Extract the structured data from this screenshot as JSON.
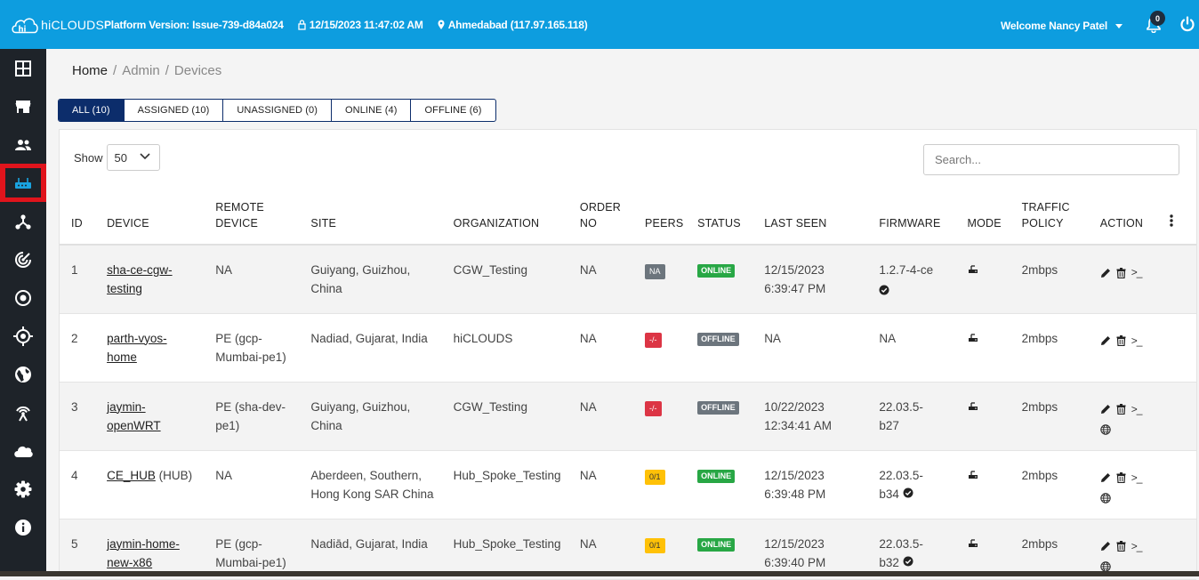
{
  "header": {
    "logo_text": "hiCLOUDS",
    "platform_version": "Platform Version: Issue-739-d84a024",
    "datetime": "12/15/2023 11:47:02 AM",
    "location": "Ahmedabad (117.97.165.118)",
    "welcome": "Welcome Nancy Patel",
    "notification_count": "0",
    "brand_color": "#0d9ddf"
  },
  "sidebar": {
    "items": [
      {
        "icon": "dashboard-grid-icon"
      },
      {
        "icon": "store-icon"
      },
      {
        "icon": "users-icon"
      },
      {
        "icon": "router-icon",
        "active": true
      },
      {
        "icon": "topology-icon"
      },
      {
        "icon": "signal-icon"
      },
      {
        "icon": "target-circle-icon"
      },
      {
        "icon": "crosshair-icon"
      },
      {
        "icon": "globe-icon"
      },
      {
        "icon": "wireless-tower-icon"
      },
      {
        "icon": "cloud-icon"
      },
      {
        "icon": "settings-gear-icon"
      },
      {
        "icon": "info-icon"
      }
    ]
  },
  "breadcrumb": {
    "home": "Home",
    "admin": "Admin",
    "devices": "Devices"
  },
  "tabs": [
    {
      "label": "ALL (10)",
      "active": true
    },
    {
      "label": "ASSIGNED (10)"
    },
    {
      "label": "UNASSIGNED (0)"
    },
    {
      "label": "ONLINE (4)"
    },
    {
      "label": "OFFLINE (6)"
    }
  ],
  "controls": {
    "show_label": "Show",
    "show_value": "50",
    "search_placeholder": "Search..."
  },
  "table": {
    "headers": {
      "id": "ID",
      "device": "DEVICE",
      "remote_1": "REMOTE",
      "remote_2": "DEVICE",
      "site": "SITE",
      "organization": "ORGANIZATION",
      "order_1": "ORDER",
      "order_2": "NO",
      "peers": "PEERS",
      "status": "STATUS",
      "last_seen": "LAST SEEN",
      "firmware": "FIRMWARE",
      "mode": "MODE",
      "traffic_1": "TRAFFIC",
      "traffic_2": "POLICY",
      "action": "ACTION"
    },
    "rows": [
      {
        "id": "1",
        "device_1": "sha-ce-cgw-",
        "device_2": "testing",
        "device_suffix": "",
        "remote_1": "NA",
        "remote_2": "",
        "site_1": "Guiyang, Guizhou,",
        "site_2": "China",
        "org": "CGW_Testing",
        "order": "NA",
        "peers": "NA",
        "peers_color": "#6c757d",
        "status": "ONLINE",
        "status_color": "#28a745",
        "seen_1": "12/15/2023",
        "seen_2": "6:39:47 PM",
        "fw_1": "1.2.7-4-ce",
        "fw_2": "",
        "traffic": "2mbps"
      },
      {
        "id": "2",
        "device_1": "parth-vyos-",
        "device_2": "home",
        "device_suffix": "",
        "remote_1": "PE (gcp-",
        "remote_2": "Mumbai-pe1)",
        "site_1": "Nadiad, Gujarat, India",
        "site_2": "",
        "org": "hiCLOUDS",
        "order": "NA",
        "peers": "-/-",
        "peers_color": "#dc3545",
        "status": "OFFLINE",
        "status_color": "#6c757d",
        "seen_1": "NA",
        "seen_2": "",
        "fw_1": "NA",
        "fw_2": "",
        "traffic": "2mbps"
      },
      {
        "id": "3",
        "device_1": "jaymin-",
        "device_2": "openWRT",
        "device_suffix": "",
        "remote_1": "PE (sha-dev-",
        "remote_2": "pe1)",
        "site_1": "Guiyang, Guizhou,",
        "site_2": "China",
        "org": "CGW_Testing",
        "order": "NA",
        "peers": "-/-",
        "peers_color": "#dc3545",
        "status": "OFFLINE",
        "status_color": "#6c757d",
        "seen_1": "10/22/2023",
        "seen_2": "12:34:41 AM",
        "fw_1": "22.03.5-",
        "fw_2": "b27",
        "traffic": "2mbps"
      },
      {
        "id": "4",
        "device_1": "CE_HUB",
        "device_2": "",
        "device_suffix": " (HUB)",
        "remote_1": "NA",
        "remote_2": "",
        "site_1": "Aberdeen, Southern,",
        "site_2": "Hong Kong SAR China",
        "org": "Hub_Spoke_Testing",
        "order": "NA",
        "peers": "0/1",
        "peers_color": "#ffc107",
        "status": "ONLINE",
        "status_color": "#28a745",
        "seen_1": "12/15/2023",
        "seen_2": "6:39:48 PM",
        "fw_1": "22.03.5-",
        "fw_2": "b34",
        "traffic": "2mbps"
      },
      {
        "id": "5",
        "device_1": "jaymin-home-",
        "device_2": "new-x86",
        "device_suffix": "",
        "remote_1": "PE (gcp-",
        "remote_2": "Mumbai-pe1)",
        "site_1": "Nadiād, Gujarat, India",
        "site_2": "",
        "org": "Hub_Spoke_Testing",
        "order": "NA",
        "peers": "0/1",
        "peers_color": "#ffc107",
        "status": "ONLINE",
        "status_color": "#28a745",
        "seen_1": "12/15/2023",
        "seen_2": "6:39:40 PM",
        "fw_1": "22.03.5-",
        "fw_2": "b32",
        "traffic": "2mbps"
      }
    ],
    "action_cmd_label": ">_"
  }
}
